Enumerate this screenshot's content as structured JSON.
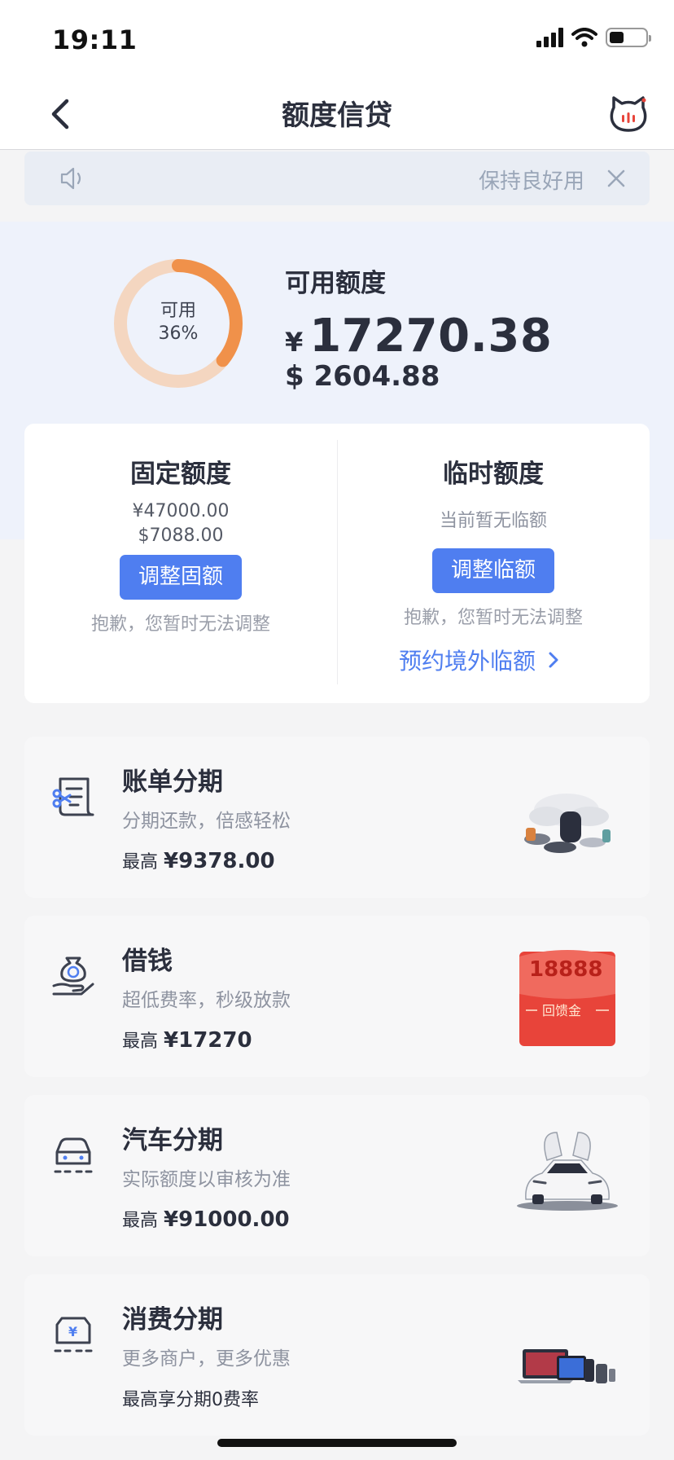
{
  "status_bar": {
    "time": "19:11"
  },
  "nav": {
    "title": "额度信贷"
  },
  "notice": {
    "text": "保持良好用"
  },
  "available": {
    "percent_label": "可用",
    "percent": "36%",
    "percent_value": 0.36,
    "title": "可用额度",
    "cny_symbol": "¥",
    "cny_amount": "17270.38",
    "usd_amount": "$ 2604.88"
  },
  "fixed_quota": {
    "title": "固定额度",
    "cny": "¥47000.00",
    "usd": "$7088.00",
    "button": "调整固额",
    "note": "抱歉，您暂时无法调整"
  },
  "temp_quota": {
    "title": "临时额度",
    "status": "当前暂无临额",
    "button": "调整临额",
    "note": "抱歉，您暂时无法调整",
    "link": "预约境外临额"
  },
  "products": [
    {
      "title": "账单分期",
      "subtitle": "分期还款，倍感轻松",
      "max_prefix": "最高",
      "max_value": "¥9378.00"
    },
    {
      "title": "借钱",
      "subtitle": "超低费率，秒级放款",
      "max_prefix": "最高",
      "max_value": "¥17270",
      "badge_amount": "18888",
      "badge_text": "回馈金"
    },
    {
      "title": "汽车分期",
      "subtitle": "实际额度以审核为准",
      "max_prefix": "最高",
      "max_value": "¥91000.00"
    },
    {
      "title": "消费分期",
      "subtitle": "更多商户，更多优惠",
      "max_prefix": "最高享分期0费率",
      "max_value": ""
    }
  ],
  "colors": {
    "accent": "#4f7ef0",
    "donut_active": "#f0914a",
    "donut_track": "#f4d6c0",
    "badge_red": "#e8443a"
  }
}
